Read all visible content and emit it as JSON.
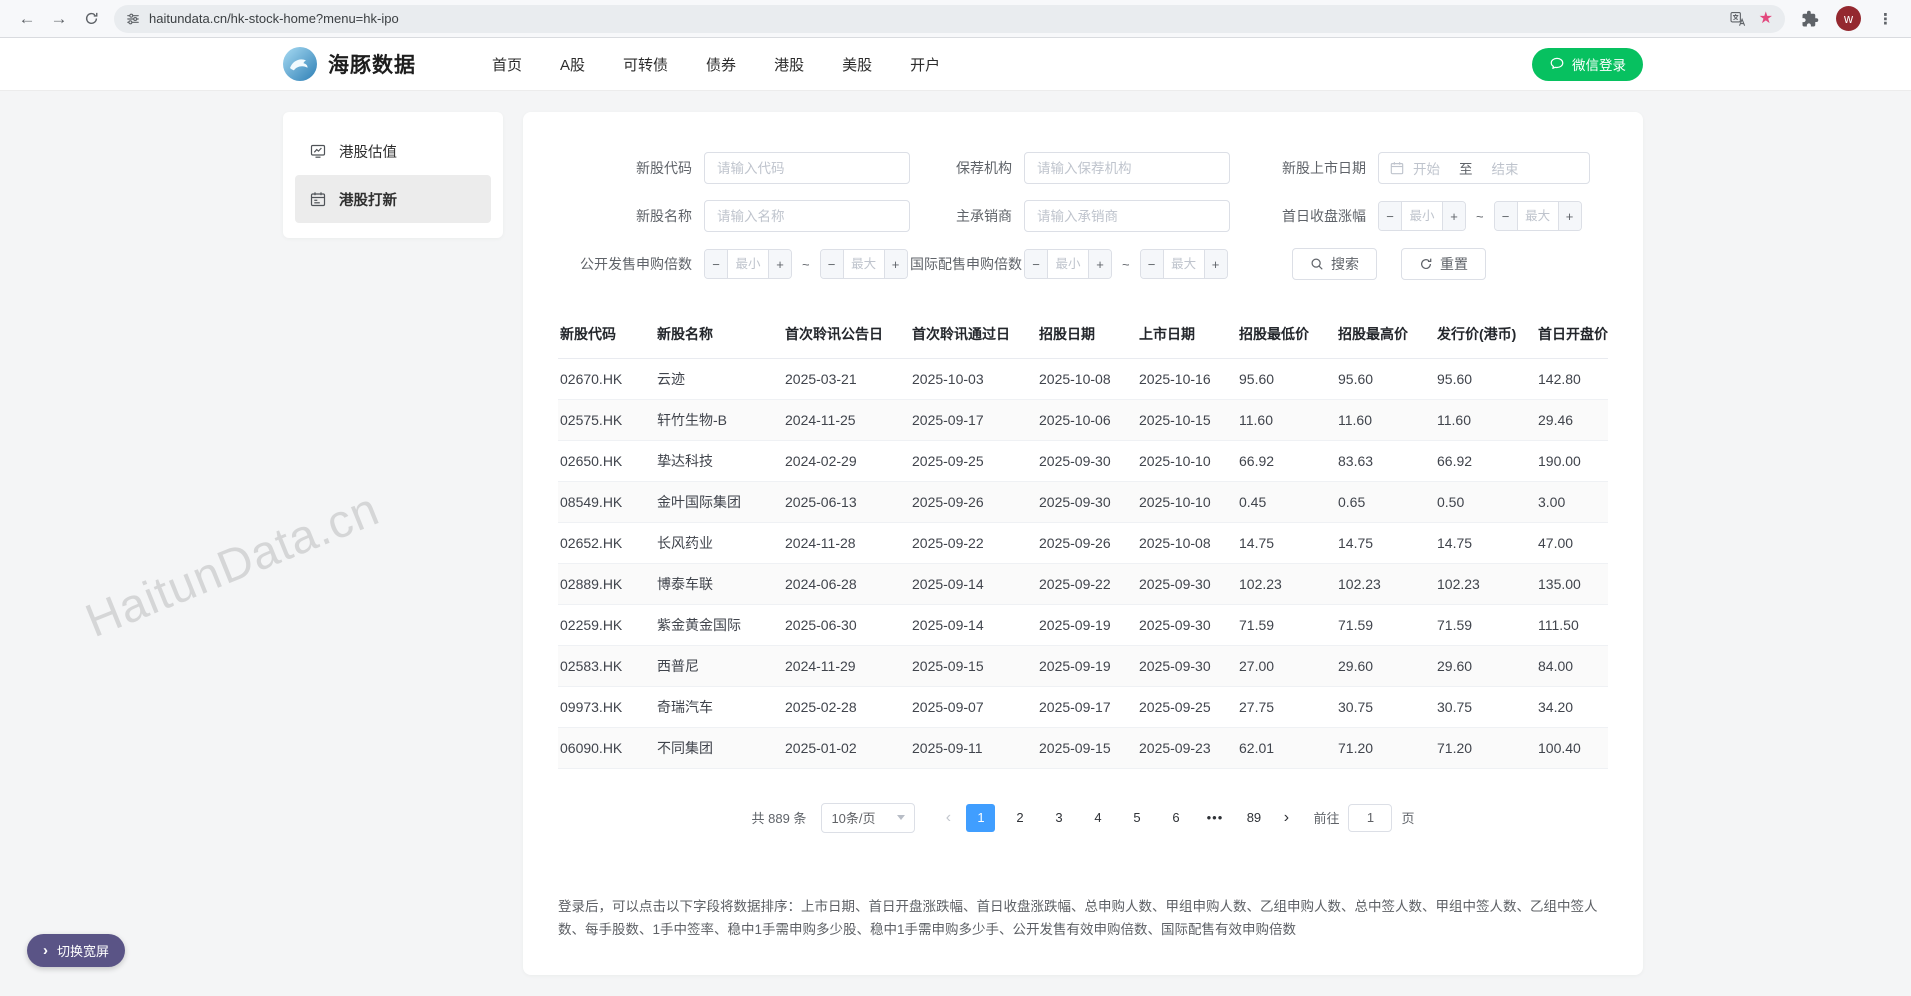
{
  "browser": {
    "url": "haitundata.cn/hk-stock-home?menu=hk-ipo",
    "profile_initial": "w"
  },
  "header": {
    "brand": "海豚数据",
    "nav": [
      "首页",
      "A股",
      "可转债",
      "债券",
      "港股",
      "美股",
      "开户"
    ],
    "login_button": "微信登录"
  },
  "sidebar": {
    "items": [
      {
        "id": "hk-valuation",
        "label": "港股估值",
        "icon": "monitor-chart-icon",
        "active": false
      },
      {
        "id": "hk-ipo",
        "label": "港股打新",
        "icon": "calendar-grid-icon",
        "active": true
      }
    ]
  },
  "filters": {
    "code_label": "新股代码",
    "code_placeholder": "请输入代码",
    "sponsor_label": "保荐机构",
    "sponsor_placeholder": "请输入保荐机构",
    "list_date_label": "新股上市日期",
    "date_start_placeholder": "开始",
    "date_separator": "至",
    "date_end_placeholder": "结束",
    "name_label": "新股名称",
    "name_placeholder": "请输入名称",
    "underwriter_label": "主承销商",
    "underwriter_placeholder": "请输入承销商",
    "first_day_gain_label": "首日收盘涨幅",
    "public_offer_multiple_label": "公开发售申购倍数",
    "intl_placing_multiple_label": "国际配售申购倍数",
    "min_placeholder": "最小",
    "max_placeholder": "最大",
    "range_separator": "~",
    "search_button": "搜索",
    "reset_button": "重置"
  },
  "table": {
    "columns": [
      "新股代码",
      "新股名称",
      "首次聆讯公告日",
      "首次聆讯通过日",
      "招股日期",
      "上市日期",
      "招股最低价",
      "招股最高价",
      "发行价(港币)",
      "首日开盘价"
    ],
    "rows": [
      [
        "02670.HK",
        "云迹",
        "2025-03-21",
        "2025-10-03",
        "2025-10-08",
        "2025-10-16",
        "95.60",
        "95.60",
        "95.60",
        "142.80"
      ],
      [
        "02575.HK",
        "轩竹生物-B",
        "2024-11-25",
        "2025-09-17",
        "2025-10-06",
        "2025-10-15",
        "11.60",
        "11.60",
        "11.60",
        "29.46"
      ],
      [
        "02650.HK",
        "挚达科技",
        "2024-02-29",
        "2025-09-25",
        "2025-09-30",
        "2025-10-10",
        "66.92",
        "83.63",
        "66.92",
        "190.00"
      ],
      [
        "08549.HK",
        "金叶国际集团",
        "2025-06-13",
        "2025-09-26",
        "2025-09-30",
        "2025-10-10",
        "0.45",
        "0.65",
        "0.50",
        "3.00"
      ],
      [
        "02652.HK",
        "长风药业",
        "2024-11-28",
        "2025-09-22",
        "2025-09-26",
        "2025-10-08",
        "14.75",
        "14.75",
        "14.75",
        "47.00"
      ],
      [
        "02889.HK",
        "博泰车联",
        "2024-06-28",
        "2025-09-14",
        "2025-09-22",
        "2025-09-30",
        "102.23",
        "102.23",
        "102.23",
        "135.00"
      ],
      [
        "02259.HK",
        "紫金黄金国际",
        "2025-06-30",
        "2025-09-14",
        "2025-09-19",
        "2025-09-30",
        "71.59",
        "71.59",
        "71.59",
        "111.50"
      ],
      [
        "02583.HK",
        "西普尼",
        "2024-11-29",
        "2025-09-15",
        "2025-09-19",
        "2025-09-30",
        "27.00",
        "29.60",
        "29.60",
        "84.00"
      ],
      [
        "09973.HK",
        "奇瑞汽车",
        "2025-02-28",
        "2025-09-07",
        "2025-09-17",
        "2025-09-25",
        "27.75",
        "30.75",
        "30.75",
        "34.20"
      ],
      [
        "06090.HK",
        "不同集团",
        "2025-01-02",
        "2025-09-11",
        "2025-09-15",
        "2025-09-23",
        "62.01",
        "71.20",
        "71.20",
        "100.40"
      ]
    ]
  },
  "pagination": {
    "total_text": "共 889 条",
    "page_size": "10条/页",
    "pages": [
      "1",
      "2",
      "3",
      "4",
      "5",
      "6",
      "•••",
      "89"
    ],
    "active_page": "1",
    "goto_label": "前往",
    "goto_value": "1",
    "goto_suffix": "页"
  },
  "footnote": "登录后，可以点击以下字段将数据排序：上市日期、首日开盘涨跌幅、首日收盘涨跌幅、总申购人数、甲组申购人数、乙组申购人数、总中签人数、甲组中签人数、乙组中签人数、每手股数、1手中签率、稳中1手需申购多少股、稳中1手需申购多少手、公开发售有效申购倍数、国际配售有效申购倍数",
  "watermark": "HaitunData.cn",
  "widescreen_button": "切换宽屏",
  "colors": {
    "brand_green": "#07c160",
    "active_page_blue": "#409eff",
    "widescreen_purple": "#5a5486",
    "bookmark_star_pink": "#e2487e",
    "avatar_red": "#94282f"
  }
}
